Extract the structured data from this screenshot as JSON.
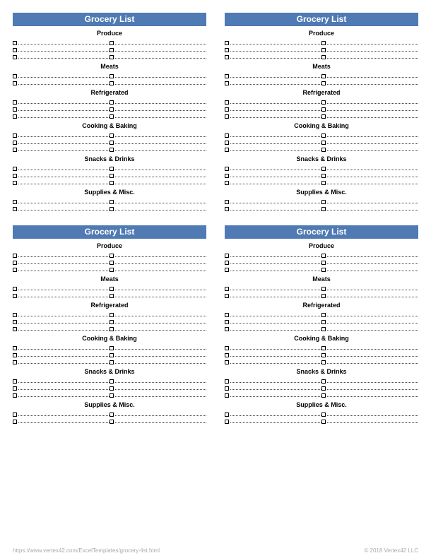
{
  "card_title": "Grocery List",
  "sections": [
    {
      "name": "Produce",
      "rows": 3
    },
    {
      "name": "Meats",
      "rows": 2
    },
    {
      "name": "Refrigerated",
      "rows": 3
    },
    {
      "name": "Cooking & Baking",
      "rows": 3
    },
    {
      "name": "Snacks & Drinks",
      "rows": 3
    },
    {
      "name": "Supplies & Misc.",
      "rows": 2
    }
  ],
  "footer": {
    "url": "https://www.vertex42.com/ExcelTemplates/grocery-list.html",
    "copyright": "© 2018 Vertex42 LLC"
  }
}
